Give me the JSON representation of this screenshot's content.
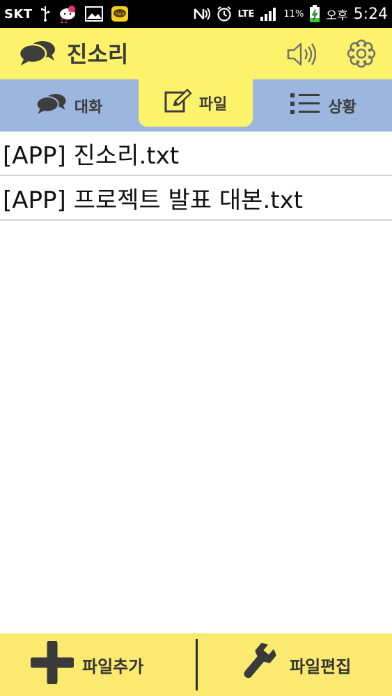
{
  "status_bar": {
    "carrier": "SKT",
    "network": "LTE",
    "battery": "11%",
    "ampm": "오후",
    "time": "5:24",
    "icons": [
      "usb-icon",
      "hello-kitty-notification-icon",
      "image-notification-icon",
      "kakaotalk-icon",
      "nfc-icon",
      "alarm-icon",
      "lte-icon",
      "signal-icon",
      "battery-charging-icon"
    ]
  },
  "header": {
    "title": "진소리",
    "icons": {
      "logo": "speech-bubbles-icon",
      "sound": "speaker-icon",
      "settings": "gear-icon"
    }
  },
  "tabs": [
    {
      "label": "대화",
      "icon": "speech-bubbles-icon",
      "selected": false
    },
    {
      "label": "파일",
      "icon": "edit-icon",
      "selected": true
    },
    {
      "label": "상황",
      "icon": "list-icon",
      "selected": false
    }
  ],
  "files": [
    {
      "name": "[APP] 진소리.txt"
    },
    {
      "name": "[APP] 프로젝트 발표 대본.txt"
    }
  ],
  "bottom_bar": {
    "add_label": "파일추가",
    "edit_label": "파일편집",
    "icons": {
      "add": "plus-icon",
      "edit": "wrench-icon"
    }
  },
  "colors": {
    "header_bg": "#fdf36a",
    "tab_bar_bg": "#9cb6e0",
    "bottom_bar_bg": "#fbe970",
    "status_bar_bg": "#000000"
  }
}
